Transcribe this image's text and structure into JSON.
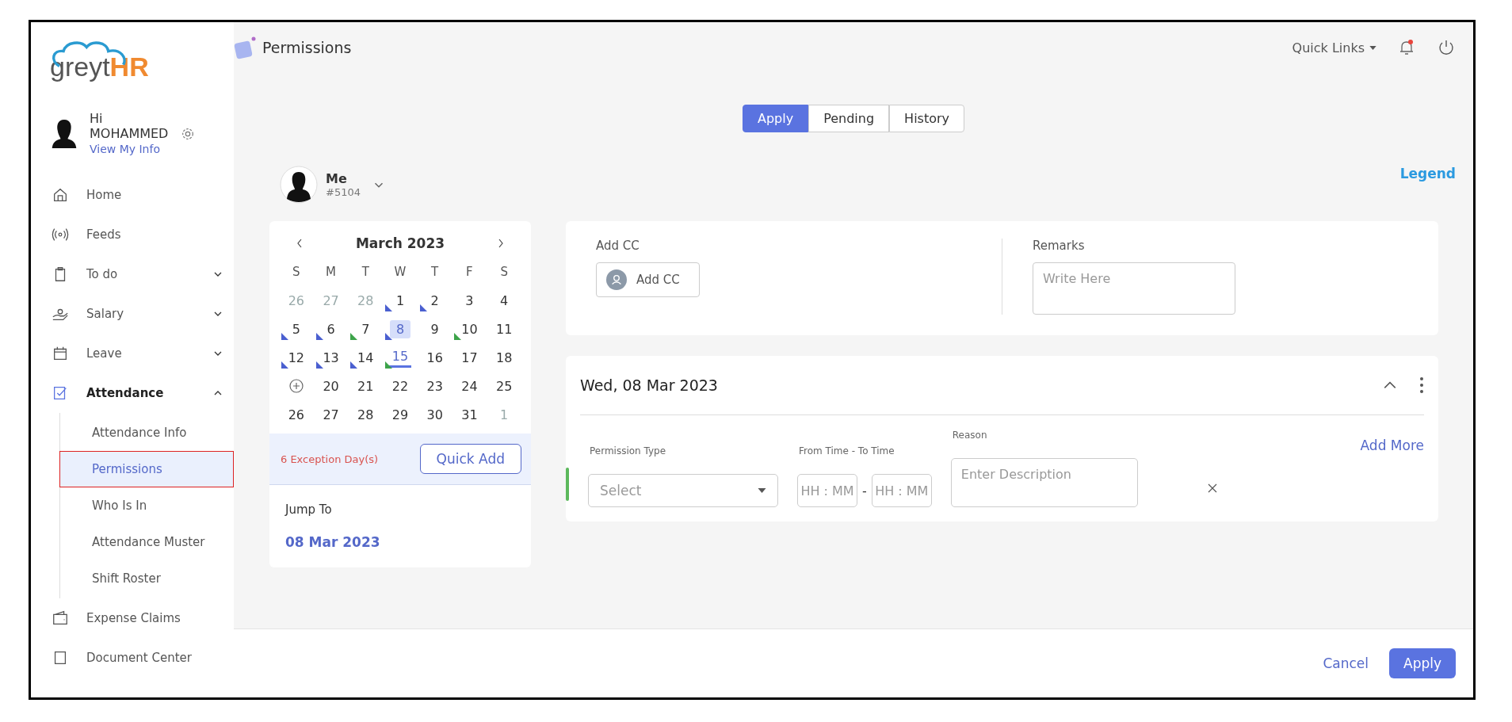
{
  "logo": {
    "part1": "greyt",
    "part2": "HR"
  },
  "user": {
    "greeting": "Hi",
    "name": "MOHAMMED",
    "link": "View My Info"
  },
  "sidebar": {
    "items": [
      {
        "label": "Home"
      },
      {
        "label": "Feeds"
      },
      {
        "label": "To do",
        "expanded": false
      },
      {
        "label": "Salary",
        "expanded": false
      },
      {
        "label": "Leave",
        "expanded": false
      },
      {
        "label": "Attendance",
        "expanded": true,
        "children": [
          {
            "label": "Attendance Info",
            "selected": false
          },
          {
            "label": "Permissions",
            "selected": true
          },
          {
            "label": "Who Is In",
            "selected": false
          },
          {
            "label": "Attendance Muster",
            "selected": false
          },
          {
            "label": "Shift Roster",
            "selected": false
          }
        ]
      },
      {
        "label": "Expense Claims"
      },
      {
        "label": "Document Center"
      }
    ]
  },
  "header": {
    "title": "Permissions",
    "quick_links": "Quick Links",
    "notification_dot": true
  },
  "tabs": [
    {
      "label": "Apply",
      "selected": true
    },
    {
      "label": "Pending",
      "selected": false
    },
    {
      "label": "History",
      "selected": false
    }
  ],
  "employee": {
    "name": "Me",
    "id": "#5104"
  },
  "legend": "Legend",
  "calendar": {
    "month": "March 2023",
    "weekdays": [
      "S",
      "M",
      "T",
      "W",
      "T",
      "F",
      "S"
    ],
    "days": [
      {
        "kind": "day",
        "label": "26",
        "muted": true,
        "selected": false,
        "today": false
      },
      {
        "kind": "day",
        "label": "27",
        "muted": true,
        "selected": false,
        "today": false
      },
      {
        "kind": "day",
        "label": "28",
        "muted": true,
        "selected": false,
        "today": false
      },
      {
        "kind": "day",
        "label": "1",
        "muted": false,
        "selected": false,
        "today": false,
        "color": "#4a5fd0"
      },
      {
        "kind": "day",
        "label": "2",
        "muted": false,
        "selected": false,
        "today": false,
        "color": "#4a5fd0"
      },
      {
        "kind": "day",
        "label": "3",
        "muted": false,
        "selected": false,
        "today": false
      },
      {
        "kind": "day",
        "label": "4",
        "muted": false,
        "selected": false,
        "today": false
      },
      {
        "kind": "day",
        "label": "5",
        "muted": false,
        "selected": false,
        "today": false,
        "color": "#4a5fd0"
      },
      {
        "kind": "day",
        "label": "6",
        "muted": false,
        "selected": false,
        "today": false,
        "color": "#4a5fd0"
      },
      {
        "kind": "day",
        "label": "7",
        "muted": false,
        "selected": false,
        "today": false,
        "color": "#3da34a"
      },
      {
        "kind": "day",
        "label": "8",
        "muted": false,
        "selected": true,
        "today": false,
        "color": "#4a5fd0"
      },
      {
        "kind": "day",
        "label": "9",
        "muted": false,
        "selected": false,
        "today": false
      },
      {
        "kind": "day",
        "label": "10",
        "muted": false,
        "selected": false,
        "today": false,
        "color": "#3da34a"
      },
      {
        "kind": "day",
        "label": "11",
        "muted": false,
        "selected": false,
        "today": false
      },
      {
        "kind": "day",
        "label": "12",
        "muted": false,
        "selected": false,
        "today": false,
        "color": "#4a5fd0"
      },
      {
        "kind": "day",
        "label": "13",
        "muted": false,
        "selected": false,
        "today": false,
        "color": "#4a5fd0"
      },
      {
        "kind": "day",
        "label": "14",
        "muted": false,
        "selected": false,
        "today": false,
        "color": "#4a5fd0"
      },
      {
        "kind": "day",
        "label": "15",
        "muted": false,
        "selected": false,
        "today": true,
        "color": "#3da34a"
      },
      {
        "kind": "day",
        "label": "16",
        "muted": false,
        "selected": false,
        "today": false
      },
      {
        "kind": "day",
        "label": "17",
        "muted": false,
        "selected": false,
        "today": false
      },
      {
        "kind": "day",
        "label": "18",
        "muted": false,
        "selected": false,
        "today": false
      },
      {
        "kind": "add"
      },
      {
        "kind": "day",
        "label": "20",
        "muted": false,
        "selected": false,
        "today": false
      },
      {
        "kind": "day",
        "label": "21",
        "muted": false,
        "selected": false,
        "today": false
      },
      {
        "kind": "day",
        "label": "22",
        "muted": false,
        "selected": false,
        "today": false
      },
      {
        "kind": "day",
        "label": "23",
        "muted": false,
        "selected": false,
        "today": false
      },
      {
        "kind": "day",
        "label": "24",
        "muted": false,
        "selected": false,
        "today": false
      },
      {
        "kind": "day",
        "label": "25",
        "muted": false,
        "selected": false,
        "today": false
      },
      {
        "kind": "day",
        "label": "26",
        "muted": false,
        "selected": false,
        "today": false
      },
      {
        "kind": "day",
        "label": "27",
        "muted": false,
        "selected": false,
        "today": false
      },
      {
        "kind": "day",
        "label": "28",
        "muted": false,
        "selected": false,
        "today": false
      },
      {
        "kind": "day",
        "label": "29",
        "muted": false,
        "selected": false,
        "today": false
      },
      {
        "kind": "day",
        "label": "30",
        "muted": false,
        "selected": false,
        "today": false
      },
      {
        "kind": "day",
        "label": "31",
        "muted": false,
        "selected": false,
        "today": false
      },
      {
        "kind": "day",
        "label": "1",
        "muted": true,
        "selected": false,
        "today": false
      }
    ],
    "exceptions": "6 Exception Day(s)",
    "quick_add": "Quick Add",
    "jump_label": "Jump To",
    "jump_date": "08 Mar 2023"
  },
  "cc": {
    "label": "Add CC",
    "button": "Add CC"
  },
  "remarks": {
    "label": "Remarks",
    "placeholder": "Write Here"
  },
  "entry": {
    "date": "Wed, 08 Mar 2023",
    "type_label": "Permission Type",
    "time_label": "From Time - To Time",
    "reason_label": "Reason",
    "add_more": "Add More",
    "type_placeholder": "Select",
    "from_placeholder": "HH : MM",
    "separator": "-",
    "to_placeholder": "HH : MM",
    "reason_placeholder": "Enter Description"
  },
  "footer": {
    "cancel": "Cancel",
    "apply": "Apply"
  }
}
